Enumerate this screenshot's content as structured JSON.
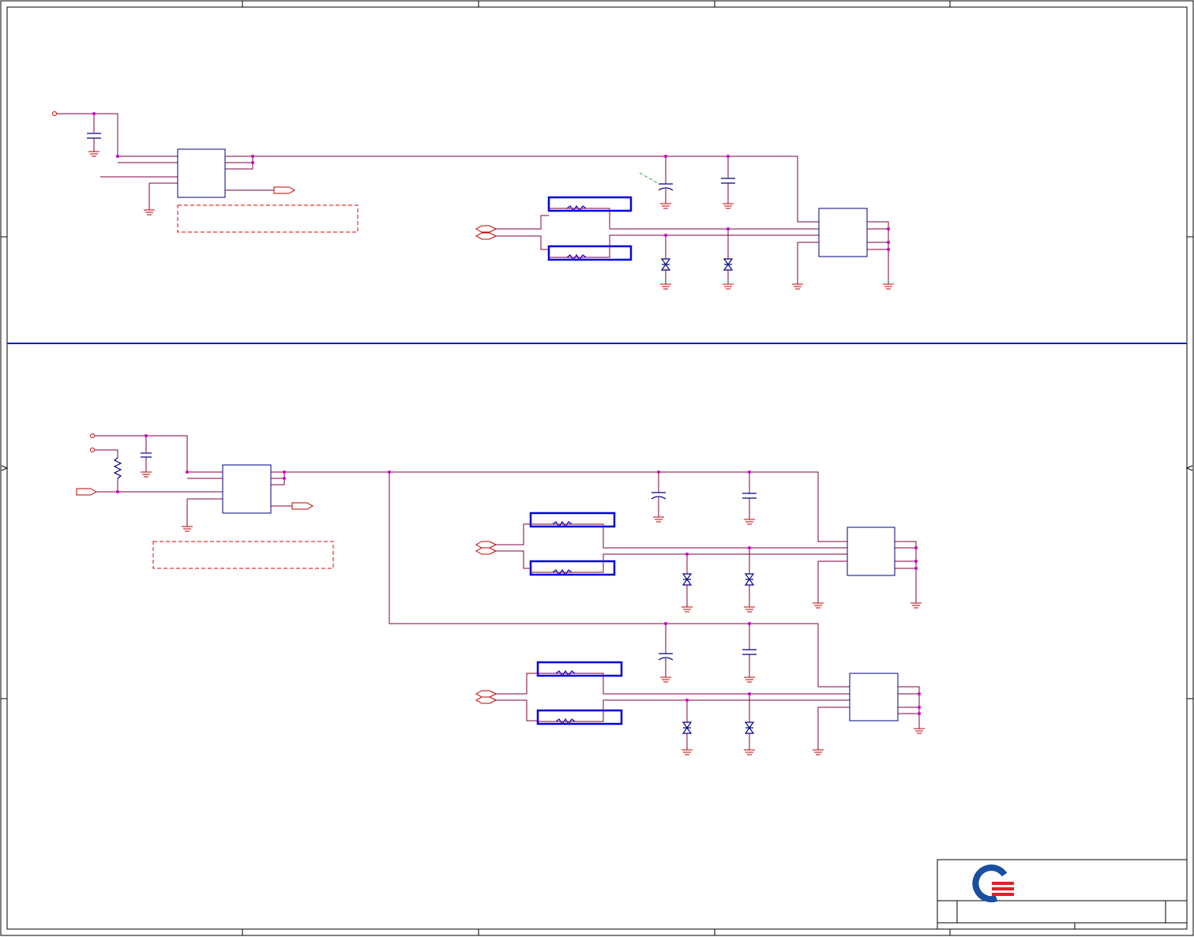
{
  "sheet": {
    "divider_color": "#0020c0",
    "wire_color": "#800040",
    "component_color": "#000080",
    "port_color": "#c00000",
    "junction_color": "#cc00cc",
    "fuse_color": "#0000e0"
  },
  "title_block": {
    "logo": {
      "icon": "quanta-logo-icon",
      "primary_color": "#1a4fa0",
      "accent_color": "#e0202a"
    }
  },
  "circuits": [
    {
      "id": "top",
      "usb_connectors": 1
    },
    {
      "id": "bottom",
      "usb_connectors": 2
    }
  ]
}
